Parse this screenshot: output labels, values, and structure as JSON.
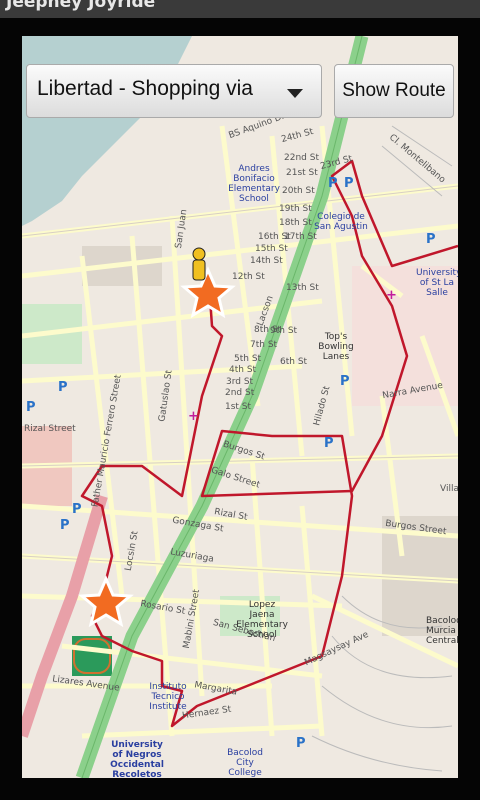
{
  "app": {
    "title": "Jeepney Joyride"
  },
  "controls": {
    "route_selected": "Libertad - Shopping via",
    "show_route_label": "Show Route"
  },
  "map": {
    "streets": [
      "BS Aquino Drive",
      "24th St",
      "23rd St",
      "22nd St",
      "21st St",
      "20th St",
      "19th St",
      "18th St",
      "17th St",
      "16th St",
      "15th St",
      "14th St",
      "13th St",
      "12th St",
      "9th St",
      "8th St",
      "7th St",
      "6th St",
      "5th St",
      "4th St",
      "3rd St",
      "2nd St",
      "1st St",
      "Lacson",
      "San Juan",
      "Gatuslao St",
      "Burgos St",
      "Galo Street",
      "Rizal St",
      "Gonzaga St",
      "Luzuriaga",
      "Rosario St",
      "Hernaez St",
      "Lizares Avenue",
      "Narra Avenue",
      "Hilado St",
      "Mabini Street",
      "San Sebastian",
      "Locsin St",
      "Magsaysay Ave",
      "Father Mauricio Ferrero Street",
      "Margarita",
      "Rizal Street",
      "Cl. Montelibano",
      "Burgos Street",
      "Villa"
    ],
    "places": [
      "Andres Bonifacio Elementary School",
      "Colegio de San Agustin",
      "University of St La Salle",
      "Top's Bowling Lanes",
      "Lopez Jaena Elementary School",
      "Bacolod Murcia Central",
      "Instituto Tecnico Institute",
      "University of Negros Occidental Recoletos",
      "Bacolod City College"
    ],
    "colors": {
      "route": "#c0172b",
      "main_road": "#8bd08b",
      "water": "#b5d0d0",
      "land": "#efe9e1",
      "road": "#fdfbcc"
    },
    "markers": [
      "star-marker-start",
      "star-marker-end",
      "user-location-icon"
    ]
  }
}
